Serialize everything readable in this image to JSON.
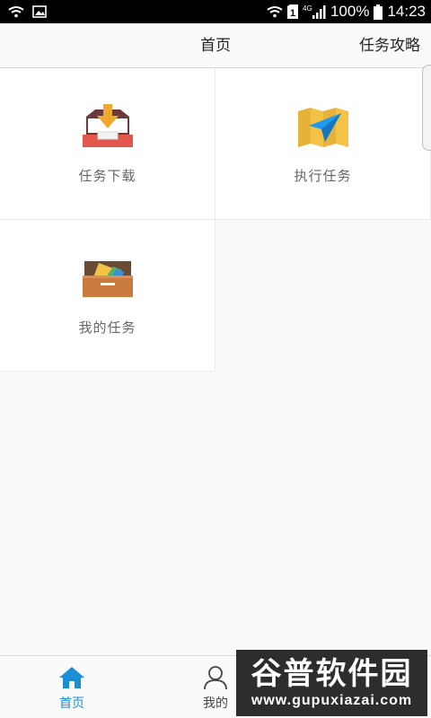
{
  "status_bar": {
    "battery": "100%",
    "time": "14:23",
    "network": "4G",
    "sim": "1"
  },
  "header": {
    "title": "首页",
    "right_link": "任务攻略"
  },
  "tiles": [
    {
      "label": "任务下载",
      "icon": "inbox-download-icon"
    },
    {
      "label": "执行任务",
      "icon": "map-navigation-icon"
    },
    {
      "label": "我的任务",
      "icon": "drawer-box-icon"
    }
  ],
  "bottom_nav": {
    "items": [
      {
        "label": "首页",
        "icon": "home-icon",
        "active": true
      },
      {
        "label": "我的",
        "icon": "person-icon",
        "active": false
      }
    ]
  },
  "watermark": {
    "main": "谷普软件园",
    "sub": "www.gupuxiazai.com"
  },
  "colors": {
    "accent": "#1b8fd6",
    "tray_red": "#e2574c",
    "arrow_orange": "#f0a830",
    "map_yellow": "#f4c247",
    "nav_blue": "#1e9bf0",
    "drawer_brown": "#c87a3f"
  }
}
